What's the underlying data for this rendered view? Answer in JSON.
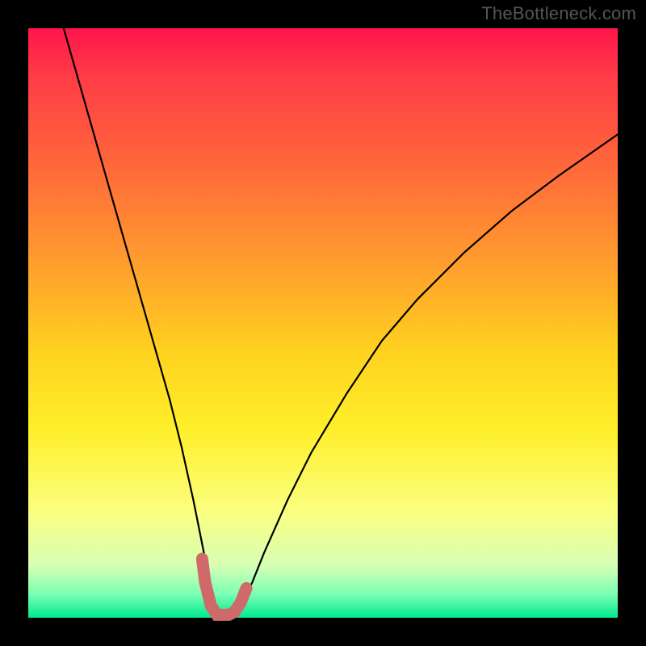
{
  "watermark": "TheBottleneck.com",
  "chart_data": {
    "type": "line",
    "title": "",
    "xlabel": "",
    "ylabel": "",
    "xlim": [
      0,
      100
    ],
    "ylim": [
      0,
      100
    ],
    "series": [
      {
        "name": "bottleneck-curve",
        "x": [
          6,
          8,
          10,
          12,
          14,
          16,
          18,
          20,
          22,
          24,
          26,
          28,
          29,
          30,
          31,
          32,
          33,
          34,
          35,
          36,
          38,
          40,
          44,
          48,
          54,
          60,
          66,
          74,
          82,
          90,
          100
        ],
        "values": [
          100,
          93,
          86,
          79,
          72,
          65,
          58,
          51,
          44,
          37,
          29,
          20,
          15,
          10,
          5,
          1,
          0,
          0,
          1,
          2,
          6,
          11,
          20,
          28,
          38,
          47,
          54,
          62,
          69,
          75,
          82
        ]
      }
    ],
    "highlight": {
      "name": "valley-highlight",
      "x": [
        29.5,
        30,
        31,
        32,
        33,
        34,
        35,
        36,
        37
      ],
      "values": [
        10,
        6,
        2,
        0.5,
        0.5,
        0.5,
        1,
        2.5,
        5
      ]
    },
    "highlight_dot": {
      "x": 29.5,
      "y": 10
    },
    "gradient_stops": [
      {
        "pos": 0,
        "color": "#ff154b"
      },
      {
        "pos": 8,
        "color": "#ff3b47"
      },
      {
        "pos": 24,
        "color": "#ff6a3a"
      },
      {
        "pos": 40,
        "color": "#ff9e2e"
      },
      {
        "pos": 55,
        "color": "#ffd21f"
      },
      {
        "pos": 68,
        "color": "#ffef2a"
      },
      {
        "pos": 82,
        "color": "#fbff80"
      },
      {
        "pos": 91,
        "color": "#d8ffb4"
      },
      {
        "pos": 96,
        "color": "#7bffb4"
      },
      {
        "pos": 100,
        "color": "#00e98f"
      }
    ]
  }
}
